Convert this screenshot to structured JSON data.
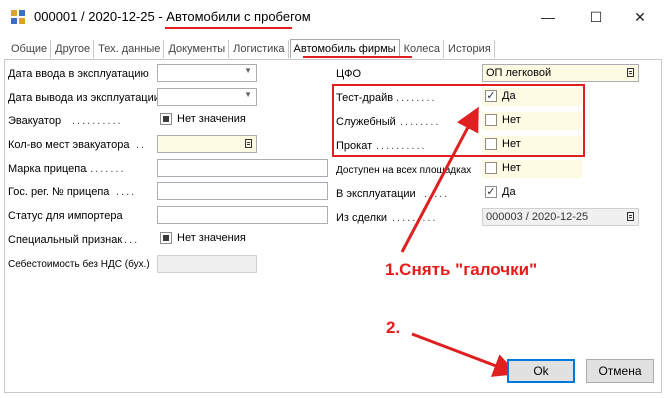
{
  "window": {
    "title_prefix": "000001 / 2020-12-25 - ",
    "title_main": "Автомобили с пробегом",
    "minimize_glyph": "—",
    "maximize_glyph": "☐",
    "close_glyph": "✕"
  },
  "tabs": [
    "Общие",
    "Другое",
    "Тех. данные",
    "Документы",
    "Логистика",
    "Автомобиль фирмы",
    "Колеса",
    "История"
  ],
  "active_tab": "Автомобиль фирмы",
  "left_fields": {
    "commission_date": {
      "label": "Дата ввода в эксплуатацию",
      "value": ""
    },
    "decommission_date": {
      "label": "Дата вывода из эксплуатации",
      "value": ""
    },
    "tow_truck": {
      "label": "Эвакуатор",
      "value": "Нет значения"
    },
    "tow_places": {
      "label": "Кол-во мест эвакуатора",
      "value": ""
    },
    "trailer_brand": {
      "label": "Марка прицепа",
      "value": ""
    },
    "trailer_reg": {
      "label": "Гос. рег. № прицепа",
      "value": ""
    },
    "importer_status": {
      "label": "Статус для импортера",
      "value": ""
    },
    "special_flag": {
      "label": "Специальный признак",
      "value": "Нет значения"
    },
    "cost_no_vat": {
      "label": "Себестоимость без НДС (бух.)",
      "value": ""
    }
  },
  "right_fields": {
    "cfo": {
      "label": "ЦФО",
      "value": "ОП легковой"
    },
    "test_drive": {
      "label": "Тест-драйв",
      "value": "Да",
      "checked": true
    },
    "service": {
      "label": "Служебный",
      "value": "Нет",
      "checked": false
    },
    "rental": {
      "label": "Прокат",
      "value": "Нет",
      "checked": false
    },
    "all_sites": {
      "label": "Доступен на всех площадках",
      "value": "Нет",
      "checked": false
    },
    "in_operation": {
      "label": "В эксплуатации",
      "value": "Да",
      "checked": true
    },
    "from_deal": {
      "label": "Из сделки",
      "value": "000003 / 2020-12-25"
    }
  },
  "annotations": {
    "step1": "1.Снять \"галочки\"",
    "step2": "2."
  },
  "buttons": {
    "ok": "Ok",
    "cancel": "Отмена"
  },
  "colors": {
    "annotation_red": "#e02020",
    "highlight_yellow": "#fdfbe3",
    "ok_border": "#0078d7"
  }
}
